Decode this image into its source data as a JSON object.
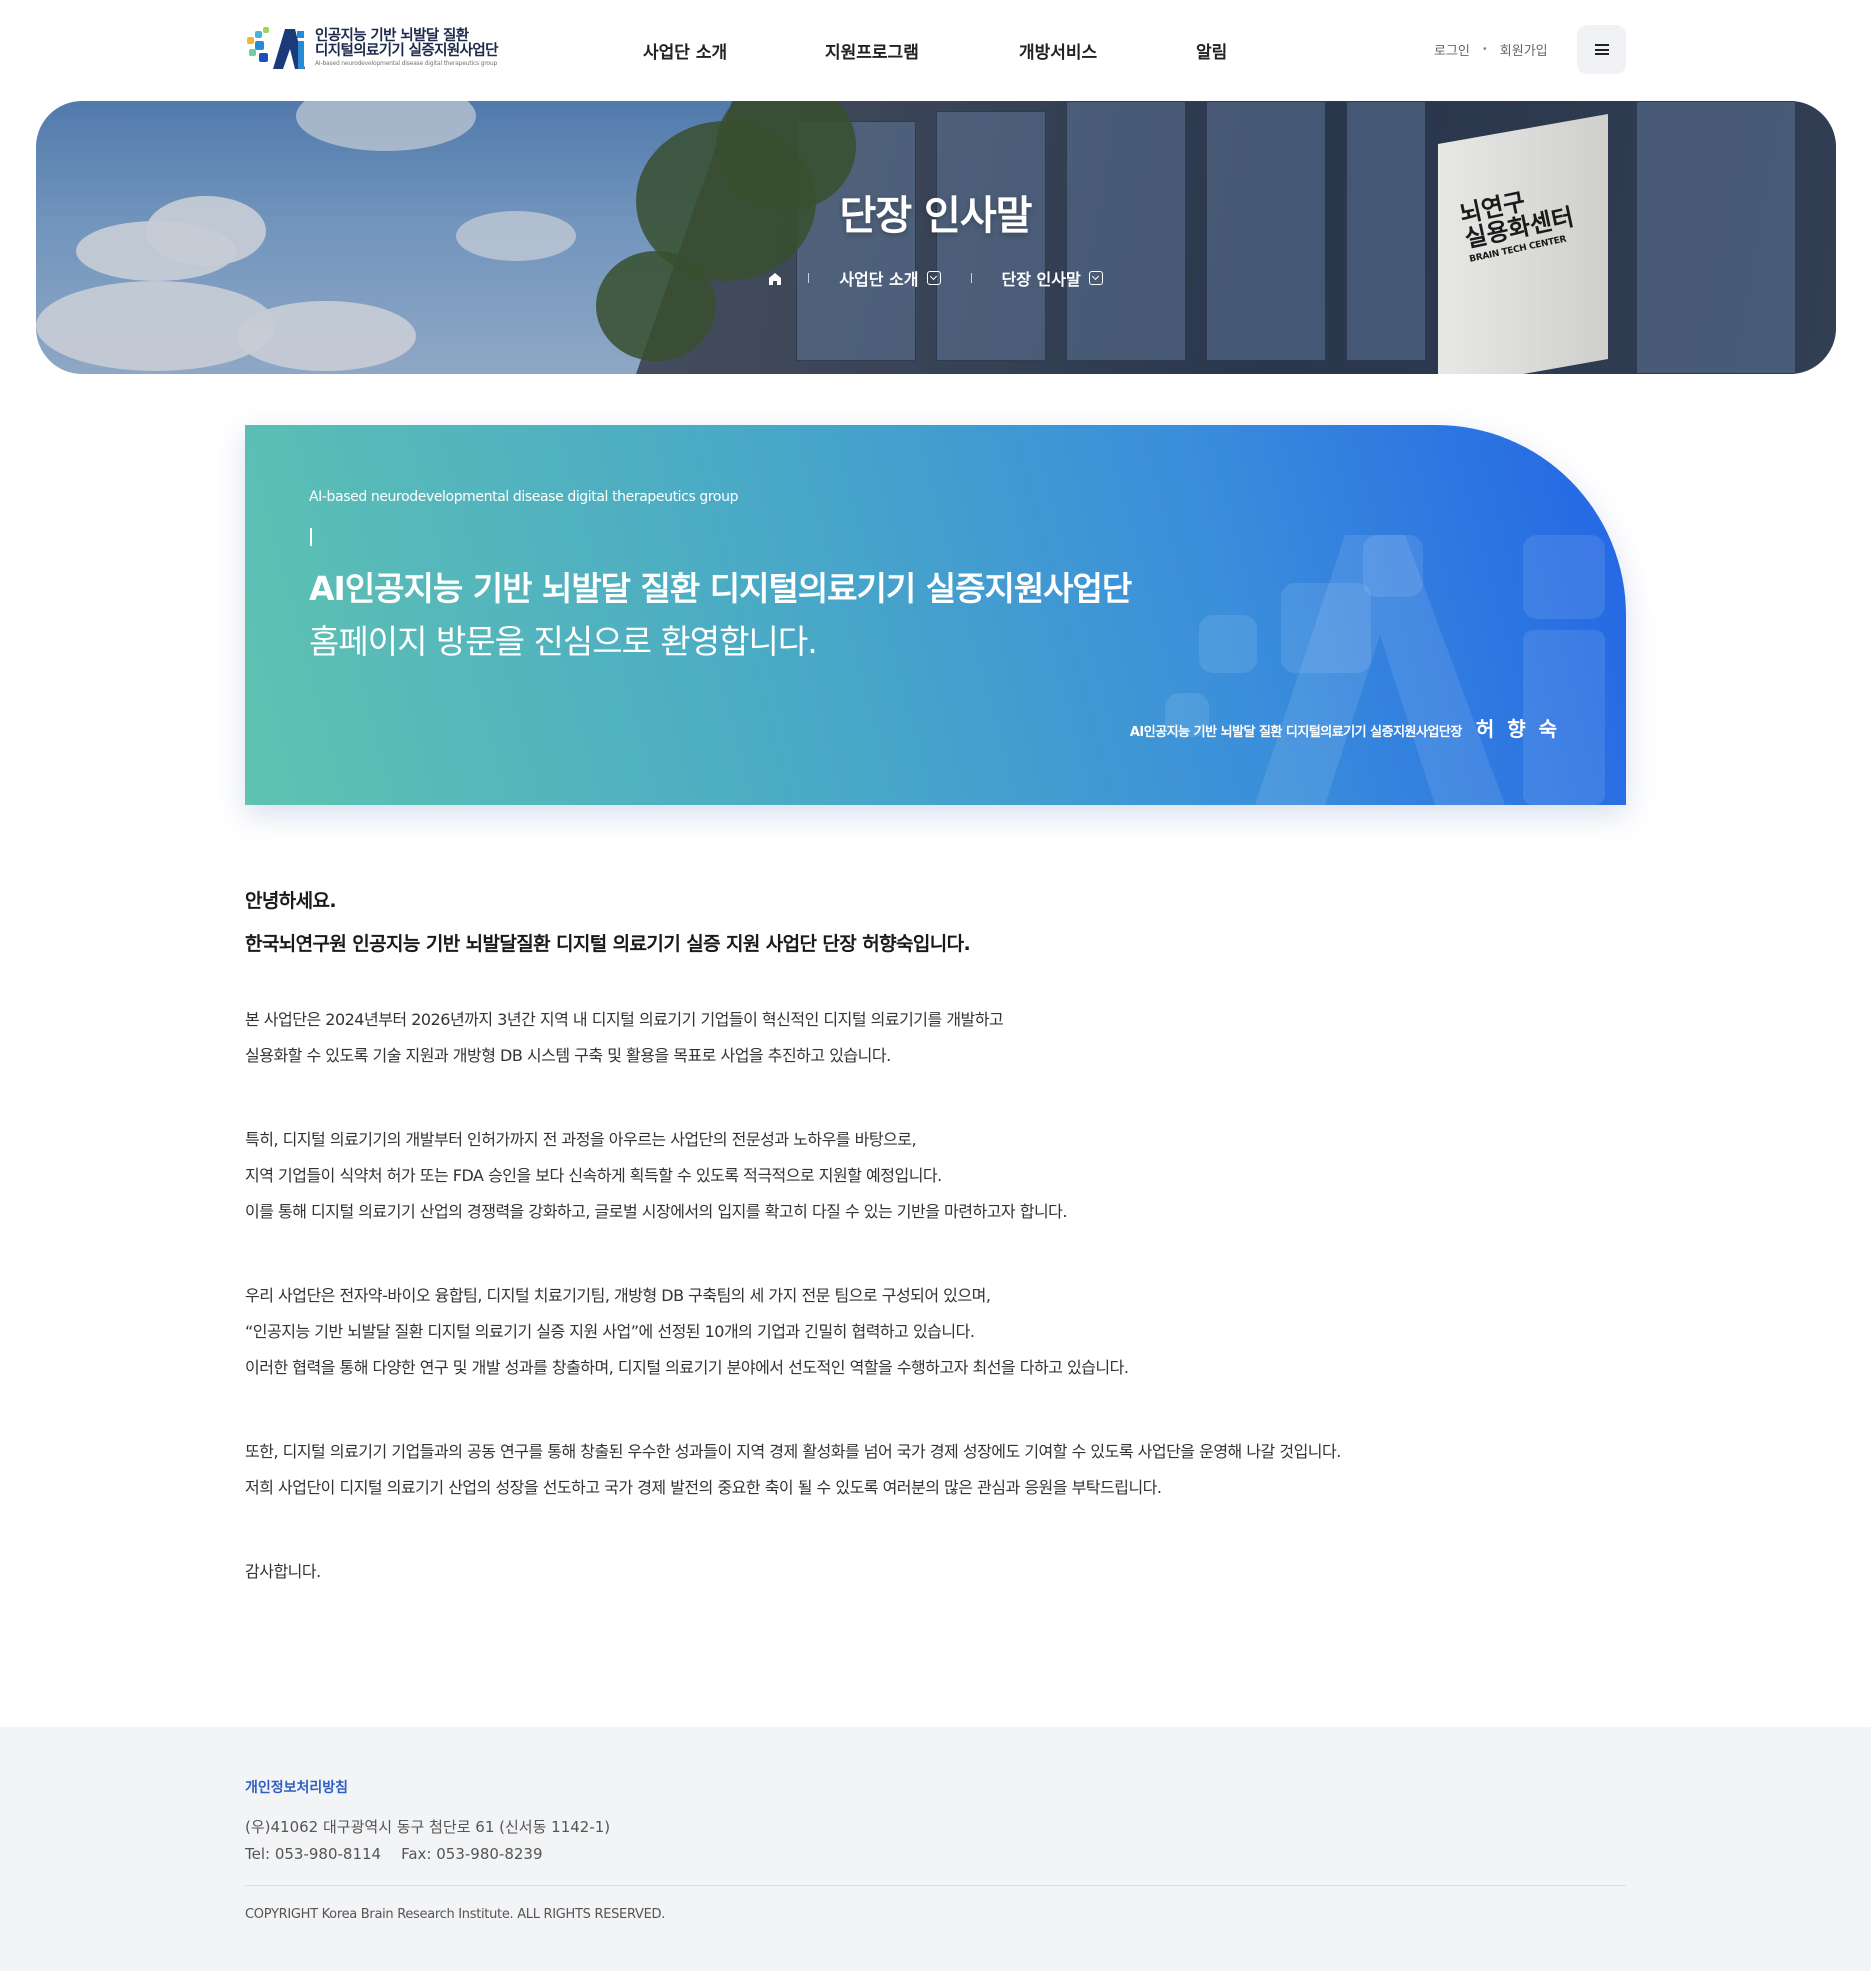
{
  "header": {
    "logo": {
      "line1": "인공지능 기반 뇌발달 질환",
      "line2": "디지털의료기기 실증지원사업단",
      "line3": "AI-based neurodevelopmental disease digital therapeutics group"
    },
    "nav": [
      {
        "label": "사업단 소개"
      },
      {
        "label": "지원프로그램"
      },
      {
        "label": "개방서비스"
      },
      {
        "label": "알림"
      }
    ],
    "util": {
      "login": "로그인",
      "signup": "회원가입"
    },
    "menu_icon": "hamburger-icon"
  },
  "visual": {
    "title": "단장 인사말",
    "breadcrumb": {
      "home_icon": "home-icon",
      "items": [
        "사업단 소개",
        "단장 인사말"
      ]
    },
    "sign": {
      "line1": "뇌연구",
      "line2": "실용화센터",
      "line3": "BRAIN TECH CENTER"
    }
  },
  "greeting_box": {
    "eng": "AI-based neurodevelopmental disease digital therapeutics group",
    "title": "AI인공지능 기반 뇌발달 질환 디지털의료기기 실증지원사업단",
    "subtitle": "홈페이지 방문을 진심으로 환영합니다.",
    "signature_role": "AI인공지능 기반 뇌발달 질환 디지털의료기기 실증지원사업단장",
    "signature_name": "허 향 숙"
  },
  "content": {
    "hello": "안녕하세요.",
    "intro": "한국뇌연구원 인공지능 기반 뇌발달질환 디지털 의료기기 실증 지원 사업단 단장 허향숙입니다.",
    "paragraphs": [
      [
        "본 사업단은 2024년부터 2026년까지 3년간 지역 내 디지털 의료기기 기업들이 혁신적인 디지털 의료기기를 개발하고",
        "실용화할 수 있도록 기술 지원과 개방형 DB 시스템 구축 및 활용을 목표로 사업을 추진하고 있습니다."
      ],
      [
        "특히, 디지털 의료기기의 개발부터 인허가까지 전 과정을 아우르는 사업단의 전문성과 노하우를 바탕으로,",
        "지역 기업들이 식약처 허가 또는 FDA 승인을 보다 신속하게 획득할 수 있도록 적극적으로 지원할 예정입니다.",
        "이를 통해 디지털 의료기기 산업의 경쟁력을 강화하고, 글로벌 시장에서의 입지를 확고히 다질 수 있는 기반을 마련하고자 합니다."
      ],
      [
        "우리 사업단은 전자약-바이오 융합팀, 디지털 치료기기팀, 개방형 DB 구축팀의 세 가지 전문 팀으로 구성되어 있으며,",
        "“인공지능 기반 뇌발달 질환 디지털 의료기기 실증 지원 사업”에 선정된 10개의 기업과 긴밀히 협력하고 있습니다.",
        "이러한 협력을 통해 다양한 연구 및 개발 성과를 창출하며, 디지털 의료기기 분야에서 선도적인 역할을 수행하고자 최선을 다하고 있습니다."
      ],
      [
        "또한, 디지털 의료기기 기업들과의 공동 연구를 통해 창출된 우수한 성과들이 지역 경제 활성화를 넘어 국가 경제 성장에도 기여할 수 있도록 사업단을 운영해 나갈 것입니다.",
        "저희 사업단이 디지털 의료기기 산업의 성장을 선도하고 국가 경제 발전의 중요한 축이 될 수 있도록 여러분의 많은 관심과 응원을 부탁드립니다."
      ],
      [
        "감사합니다."
      ]
    ]
  },
  "footer": {
    "privacy": "개인정보처리방침",
    "address": "(우)41062 대구광역시 동구 첨단로 61 (신서동 1142-1)",
    "tel": "Tel: 053-980-8114",
    "fax": "Fax: 053-980-8239",
    "copyright": "COPYRIGHT Korea Brain Research Institute. ALL RIGHTS RESERVED."
  },
  "colors": {
    "accent_blue": "#2465e5",
    "accent_teal": "#5fc3b1",
    "footer_link": "#2f5fc4"
  }
}
